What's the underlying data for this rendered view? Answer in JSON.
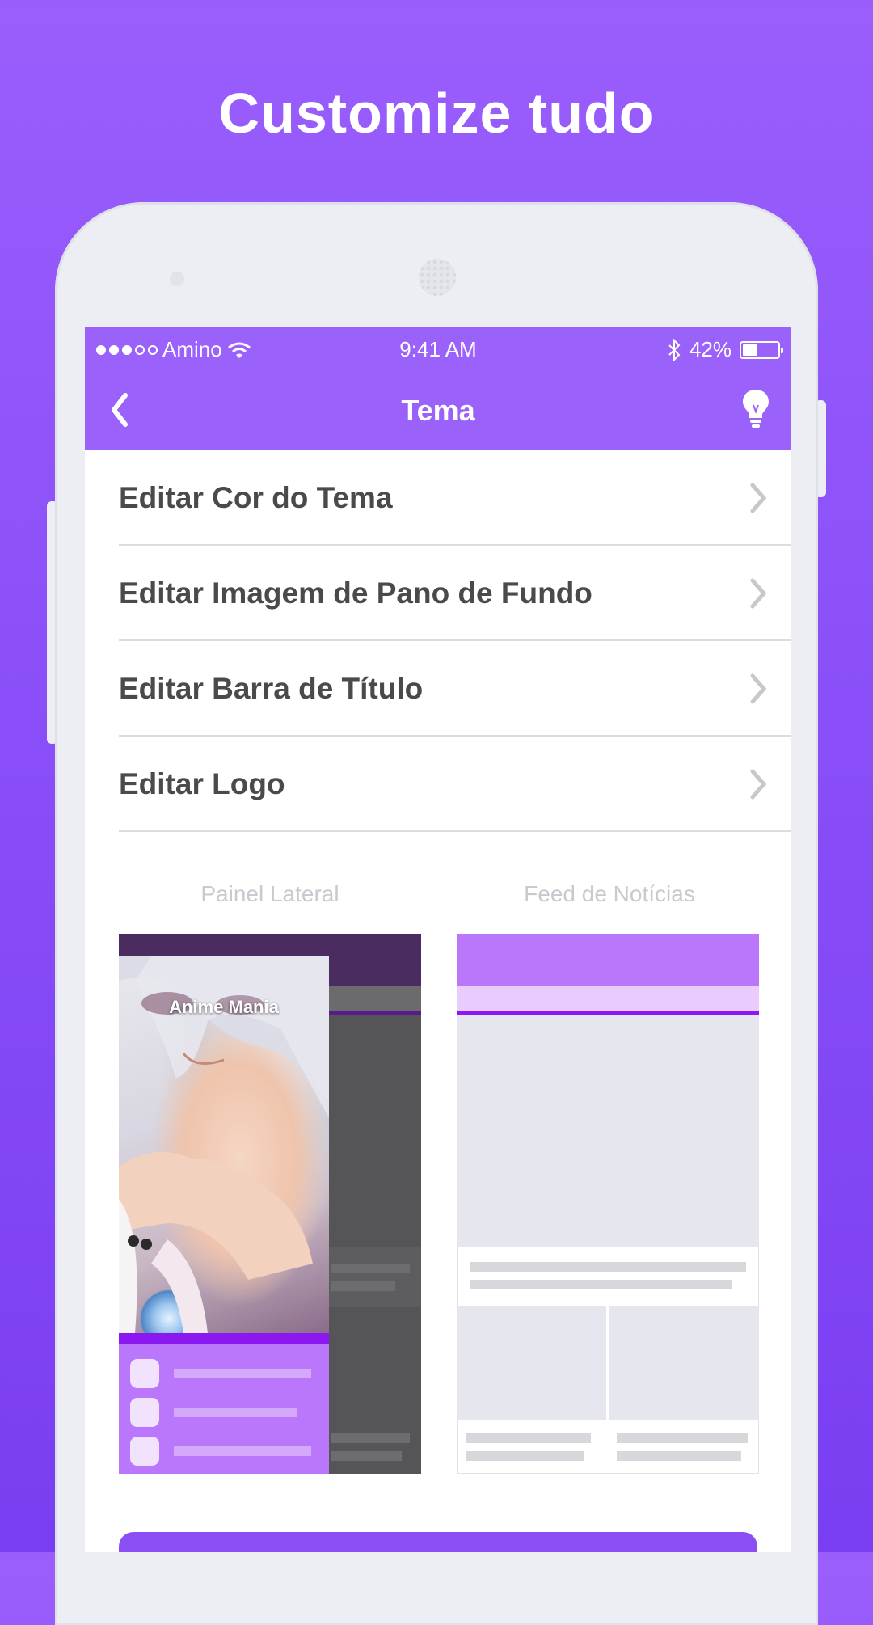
{
  "headline": "Customize tudo",
  "status_bar": {
    "carrier": "Amino",
    "time": "9:41 AM",
    "battery": "42%",
    "battery_level": 0.42
  },
  "header": {
    "title": "Tema",
    "back_icon": "chevron-left-icon",
    "right_icon": "lightbulb-icon"
  },
  "menu": [
    {
      "label": "Editar Cor do Tema"
    },
    {
      "label": "Editar Imagem de Pano de Fundo"
    },
    {
      "label": "Editar Barra de Título"
    },
    {
      "label": "Editar Logo"
    }
  ],
  "previews": {
    "side_panel_label": "Painel Lateral",
    "feed_label": "Feed de Notícias",
    "side_panel_community": "Anime Mania"
  },
  "colors": {
    "background": "#8a4ff8",
    "accent": "#9a62fb",
    "accent_dark": "#8b18f0",
    "preview_purple": "#bb77fb",
    "preview_purple_light": "#e9ccfd"
  }
}
